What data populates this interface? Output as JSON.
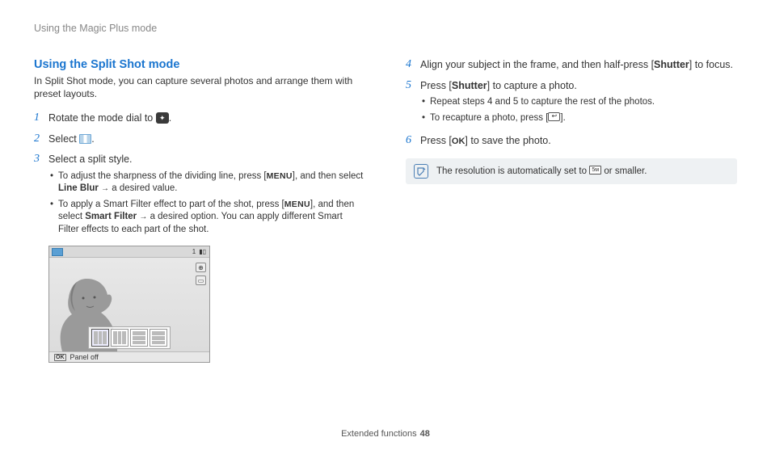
{
  "header": {
    "breadcrumb": "Using the Magic Plus mode"
  },
  "section": {
    "title": "Using the Split Shot mode",
    "intro": "In Split Shot mode, you can capture several photos and arrange them with preset layouts."
  },
  "steps": {
    "s1": {
      "num": "1",
      "prefix": "Rotate the mode dial to ",
      "suffix": "."
    },
    "s2": {
      "num": "2",
      "prefix": "Select ",
      "suffix": "."
    },
    "s3": {
      "num": "3",
      "text": "Select a split style.",
      "b1_pre": "To adjust the sharpness of the dividing line, press [",
      "b1_mid": "], and then select ",
      "b1_bold": "Line Blur",
      "b1_end": " a desired value.",
      "b2_pre": "To apply a Smart Filter effect to part of the shot, press [",
      "b2_mid": "], and then select ",
      "b2_bold": "Smart Filter",
      "b2_end": " a desired option. You can apply different Smart Filter effects to each part of the shot."
    },
    "s4": {
      "num": "4",
      "pre": "Align your subject in the frame, and then half-press [",
      "bold": "Shutter",
      "post": "] to focus."
    },
    "s5": {
      "num": "5",
      "pre": "Press [",
      "bold": "Shutter",
      "post": "] to capture a photo.",
      "b1": "Repeat steps 4 and 5 to capture the rest of the photos.",
      "b2_pre": "To recapture a photo, press [",
      "b2_post": "]."
    },
    "s6": {
      "num": "6",
      "pre": "Press [",
      "post": "] to save the photo."
    }
  },
  "labels": {
    "menu": "MENU",
    "ok": "OK",
    "arrow": "→"
  },
  "mockup": {
    "count": "1",
    "panel_off": "Panel off",
    "ok": "OK"
  },
  "note": {
    "text_pre": "The resolution is automatically set to ",
    "text_post": " or smaller."
  },
  "footer": {
    "label": "Extended functions",
    "page": "48"
  }
}
